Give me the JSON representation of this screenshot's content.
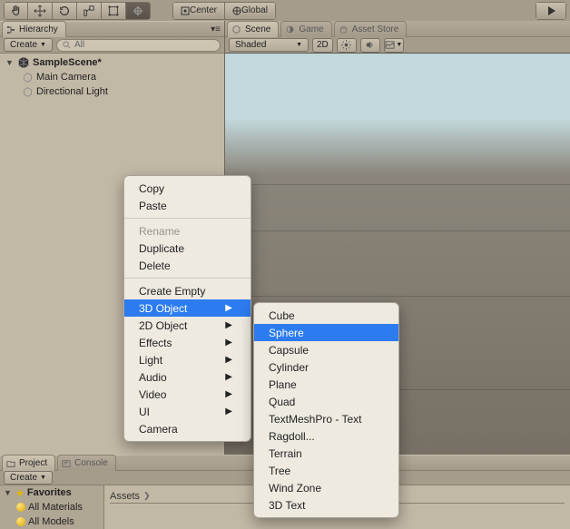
{
  "toolbar": {
    "hand": "hand-tool",
    "move": "move-tool",
    "rotate": "rotate-tool",
    "scale": "scale-tool",
    "rect": "rect-tool",
    "transform": "transform-tool",
    "pivot_label": "Center",
    "handle_label": "Global"
  },
  "hierarchy": {
    "title": "Hierarchy",
    "create_label": "Create",
    "search_placeholder": "All",
    "scene": "SampleScene*",
    "items": [
      "Main Camera",
      "Directional Light"
    ]
  },
  "scene_tabs": {
    "scene": "Scene",
    "game": "Game",
    "asset_store": "Asset Store"
  },
  "scene_toolbar": {
    "draw_mode": "Shaded",
    "view_2d": "2D"
  },
  "context_menu": {
    "items": [
      {
        "label": "Copy"
      },
      {
        "label": "Paste"
      },
      {
        "sep": true
      },
      {
        "label": "Rename",
        "disabled": true
      },
      {
        "label": "Duplicate"
      },
      {
        "label": "Delete"
      },
      {
        "sep": true
      },
      {
        "label": "Create Empty"
      },
      {
        "label": "3D Object",
        "submenu": true,
        "selected": true
      },
      {
        "label": "2D Object",
        "submenu": true
      },
      {
        "label": "Effects",
        "submenu": true
      },
      {
        "label": "Light",
        "submenu": true
      },
      {
        "label": "Audio",
        "submenu": true
      },
      {
        "label": "Video",
        "submenu": true
      },
      {
        "label": "UI",
        "submenu": true
      },
      {
        "label": "Camera"
      }
    ]
  },
  "submenu_3d": {
    "items": [
      "Cube",
      "Sphere",
      "Capsule",
      "Cylinder",
      "Plane",
      "Quad",
      "TextMeshPro - Text",
      "Ragdoll...",
      "Terrain",
      "Tree",
      "Wind Zone",
      "3D Text"
    ],
    "selected": "Sphere"
  },
  "project_pane": {
    "project_tab": "Project",
    "console_tab": "Console",
    "create_label": "Create",
    "favorites": "Favorites",
    "fav_items": [
      "All Materials",
      "All Models"
    ],
    "breadcrumb": "Assets"
  }
}
